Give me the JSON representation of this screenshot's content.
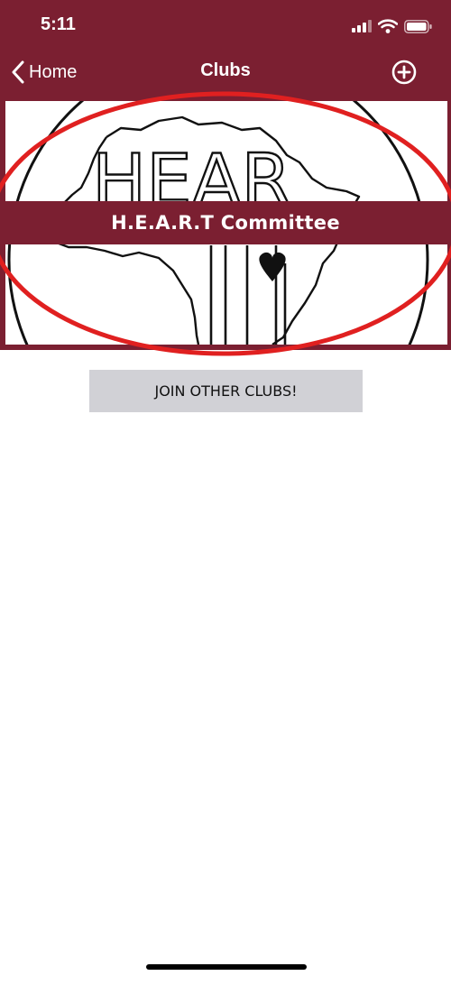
{
  "status_bar": {
    "time": "5:11",
    "icons": [
      "cellular-signal-icon",
      "wifi-icon",
      "battery-icon"
    ]
  },
  "nav": {
    "back_label": "Home",
    "title": "Clubs",
    "back_icon": "chevron-left-icon",
    "action_icon": "plus-circle-icon"
  },
  "club_card": {
    "name": "H.E.A.R.T Committee",
    "logo_letters": "HEAR"
  },
  "join_button": {
    "label": "JOIN OTHER CLUBS!"
  },
  "colors": {
    "brand": "#7b1f31",
    "annotation": "#e02020",
    "button_bg": "#d1d1d6"
  }
}
